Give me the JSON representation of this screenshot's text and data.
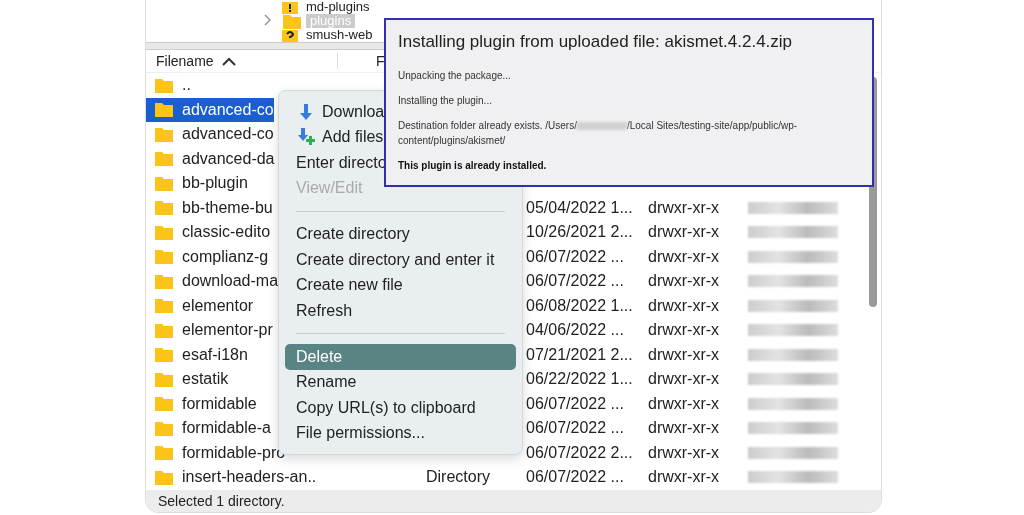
{
  "tree": [
    {
      "label": "md-plugins",
      "selected": false,
      "chevron": false
    },
    {
      "label": "plugins",
      "selected": true,
      "chevron": true
    },
    {
      "label": "smush-web",
      "selected": false,
      "chevron": false
    }
  ],
  "columns": [
    {
      "label": "Filename",
      "sorted": true
    },
    {
      "label": "F",
      "sorted": false
    }
  ],
  "rows": [
    {
      "name": "..",
      "selected": false
    },
    {
      "name": "advanced-co",
      "selected": true
    },
    {
      "name": "advanced-co",
      "selected": false
    },
    {
      "name": "advanced-da",
      "selected": false
    },
    {
      "name": "bb-plugin",
      "selected": false
    },
    {
      "name": "bb-theme-bu",
      "selected": false,
      "modified": "05/04/2022 1...",
      "permissions": "drwxr-xr-x"
    },
    {
      "name": "classic-edito",
      "selected": false,
      "modified": "10/26/2021 2...",
      "permissions": "drwxr-xr-x"
    },
    {
      "name": "complianz-g",
      "selected": false,
      "modified": "06/07/2022 ...",
      "permissions": "drwxr-xr-x"
    },
    {
      "name": "download-ma",
      "selected": false,
      "modified": "06/07/2022 ...",
      "permissions": "drwxr-xr-x"
    },
    {
      "name": "elementor",
      "selected": false,
      "modified": "06/08/2022 1...",
      "permissions": "drwxr-xr-x"
    },
    {
      "name": "elementor-pr",
      "selected": false,
      "modified": "04/06/2022 ...",
      "permissions": "drwxr-xr-x"
    },
    {
      "name": "esaf-i18n",
      "selected": false,
      "modified": "07/21/2021 2...",
      "permissions": "drwxr-xr-x"
    },
    {
      "name": "estatik",
      "selected": false,
      "modified": "06/22/2022 1...",
      "permissions": "drwxr-xr-x"
    },
    {
      "name": "formidable",
      "selected": false,
      "modified": "06/07/2022 ...",
      "permissions": "drwxr-xr-x"
    },
    {
      "name": "formidable-a",
      "selected": false,
      "modified": "06/07/2022 ...",
      "permissions": "drwxr-xr-x"
    },
    {
      "name": "formidable-pro",
      "selected": false,
      "modified": "06/07/2022 2...",
      "permissions": "drwxr-xr-x"
    },
    {
      "name": "insert-headers-an..",
      "selected": false,
      "type": "Directory",
      "modified": "06/07/2022 ...",
      "permissions": "drwxr-xr-x"
    }
  ],
  "status_bar": "Selected 1 directory.",
  "context_menu": [
    {
      "kind": "item",
      "label": "Downloa",
      "disabled": false,
      "selected": false
    },
    {
      "kind": "item",
      "label": "Add files",
      "disabled": false,
      "selected": false
    },
    {
      "kind": "item",
      "label": "Enter directo",
      "disabled": false,
      "selected": false
    },
    {
      "kind": "item",
      "label": "View/Edit",
      "disabled": true,
      "selected": false
    },
    {
      "kind": "separator"
    },
    {
      "kind": "item",
      "label": "Create directory",
      "disabled": false,
      "selected": false
    },
    {
      "kind": "item",
      "label": "Create directory and enter it",
      "disabled": false,
      "selected": false
    },
    {
      "kind": "item",
      "label": "Create new file",
      "disabled": false,
      "selected": false
    },
    {
      "kind": "item",
      "label": "Refresh",
      "disabled": false,
      "selected": false
    },
    {
      "kind": "separator"
    },
    {
      "kind": "item",
      "label": "Delete",
      "disabled": false,
      "selected": true
    },
    {
      "kind": "item",
      "label": "Rename",
      "disabled": false,
      "selected": false
    },
    {
      "kind": "item",
      "label": "Copy URL(s) to clipboard",
      "disabled": false,
      "selected": false
    },
    {
      "kind": "item",
      "label": "File permissions...",
      "disabled": false,
      "selected": false
    }
  ],
  "dialog": {
    "title": "Installing plugin from uploaded file: akismet.4.2.4.zip",
    "messages": [
      {
        "kind": "plain",
        "parts": [
          "Unpacking the package..."
        ]
      },
      {
        "kind": "plain",
        "parts": [
          "Installing the plugin..."
        ]
      },
      {
        "kind": "plain",
        "parts": [
          "Destination folder already exists. /Users/",
          "/Local Sites/testing-site/app/public/wp-content/plugins/akismet/"
        ]
      },
      {
        "kind": "notice",
        "parts": [
          "This plugin is already installed."
        ]
      }
    ]
  }
}
